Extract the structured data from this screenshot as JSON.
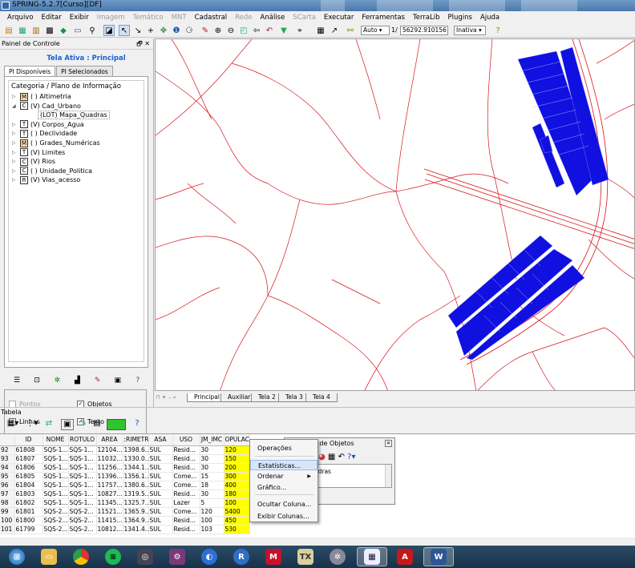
{
  "window": {
    "title": "SPRING-5.2.7[Curso][DF]"
  },
  "menu": [
    {
      "label": "Arquivo",
      "enabled": true
    },
    {
      "label": "Editar",
      "enabled": true
    },
    {
      "label": "Exibir",
      "enabled": true
    },
    {
      "label": "Imagem",
      "enabled": false
    },
    {
      "label": "Temático",
      "enabled": false
    },
    {
      "label": "MNT",
      "enabled": false
    },
    {
      "label": "Cadastral",
      "enabled": true
    },
    {
      "label": "Rede",
      "enabled": false
    },
    {
      "label": "Análise",
      "enabled": true
    },
    {
      "label": "SCarta",
      "enabled": false
    },
    {
      "label": "Executar",
      "enabled": true
    },
    {
      "label": "Ferramentas",
      "enabled": true
    },
    {
      "label": "TerraLib",
      "enabled": true
    },
    {
      "label": "Plugins",
      "enabled": true
    },
    {
      "label": "Ajuda",
      "enabled": true
    }
  ],
  "toolbar": {
    "scale_mode": "Auto",
    "scale_prefix": "1/",
    "scale_value": "56292.910156",
    "state": "Inativa"
  },
  "panel": {
    "title": "Painel de Controle",
    "close_glyph": "🗗 ✕",
    "active_plane": "Tela Ativa : Principal",
    "tabs": [
      "PI Disponíveis",
      "PI Selecionados"
    ],
    "category_header": "Categoria / Plano de Informação",
    "tree": [
      {
        "icon": "M",
        "label": "( ) Altimetria",
        "expanded": false
      },
      {
        "icon": "C",
        "label": "(V) Cad_Urbano",
        "expanded": true
      },
      {
        "icon": "",
        "label": "(LOT) Mapa_Quadras",
        "child": true
      },
      {
        "icon": "T",
        "label": "(V) Corpos_Agua",
        "expanded": false
      },
      {
        "icon": "T",
        "label": "( ) Declividade",
        "expanded": false
      },
      {
        "icon": "M",
        "label": "( ) Grades_Numéricas",
        "expanded": false
      },
      {
        "icon": "T",
        "label": "(V) Limites",
        "expanded": false
      },
      {
        "icon": "C",
        "label": "(V) Rios",
        "expanded": false
      },
      {
        "icon": "C",
        "label": "( ) Unidade_Politica",
        "expanded": false
      },
      {
        "icon": "R",
        "label": "(V) Vias_acesso",
        "expanded": false
      }
    ],
    "visibility": {
      "pontos": {
        "label": "Pontos",
        "checked": false
      },
      "objetos": {
        "label": "Objetos",
        "checked": true
      },
      "linhas": {
        "label": "Linhas",
        "checked": true
      },
      "texto": {
        "label": "Texto",
        "checked": true
      }
    }
  },
  "map_tabs": [
    "Principal",
    "Auxiliar",
    "Tela 2",
    "Tela 3",
    "Tela 4"
  ],
  "map_tab_nav": "⊓ ✦ – »",
  "colors": {
    "block_fill": "#1010e0",
    "road_line": "#d8141c",
    "highlight": "#ffff00"
  },
  "table": {
    "title": "Tabela",
    "columns": [
      "",
      "ID",
      "NOME",
      "ROTULO",
      "AREA",
      ":RIMETR",
      "ASA",
      "USO",
      "JM_IMC",
      "OPULAC"
    ],
    "rows": [
      [
        "92",
        "61808",
        "SQS-1...",
        "SQS-1...",
        "12104...",
        "1398.6...",
        "SUL",
        "Resid...",
        "30",
        "120"
      ],
      [
        "93",
        "61807",
        "SQS-1...",
        "SQS-1...",
        "11032...",
        "1330.0...",
        "SUL",
        "Resid...",
        "30",
        "150"
      ],
      [
        "94",
        "61806",
        "SQS-1...",
        "SQS-1...",
        "11256...",
        "1344.1...",
        "SUL",
        "Resid...",
        "30",
        "200"
      ],
      [
        "95",
        "61805",
        "SQS-1...",
        "SQS-1...",
        "11396...",
        "1356.1...",
        "SUL",
        "Come...",
        "15",
        "300"
      ],
      [
        "96",
        "61804",
        "SQS-1...",
        "SQS-1...",
        "11757...",
        "1380.6...",
        "SUL",
        "Come...",
        "18",
        "400"
      ],
      [
        "97",
        "61803",
        "SQS-1...",
        "SQS-1...",
        "10827...",
        "1319.5...",
        "SUL",
        "Resid...",
        "30",
        "180"
      ],
      [
        "98",
        "61802",
        "SQS-1...",
        "SQS-1...",
        "11345...",
        "1325.7...",
        "SUL",
        "Lazer",
        "5",
        "100"
      ],
      [
        "99",
        "61801",
        "SQS-2...",
        "SQS-2...",
        "11521...",
        "1365.9...",
        "SUL",
        "Come...",
        "120",
        "5400"
      ],
      [
        "100",
        "61800",
        "SQS-2...",
        "SQS-2...",
        "11415...",
        "1364.9...",
        "SUL",
        "Resid...",
        "100",
        "450"
      ],
      [
        "101",
        "61799",
        "SQS-2...",
        "SQS-2...",
        "10812...",
        "1341.4...",
        "SUL",
        "Resid...",
        "103",
        "530"
      ]
    ]
  },
  "context_menu": [
    {
      "label": "Operações"
    },
    {
      "label": "Estatísticas...",
      "hover": true
    },
    {
      "label": "Ordenar",
      "submenu": true
    },
    {
      "label": "Gráfico..."
    },
    {
      "label": "Ocultar Coluna..."
    },
    {
      "label": "Exibir Colunas..."
    }
  ],
  "objects_dialog": {
    "title": "o de Objetos",
    "list_item": "adras"
  },
  "taskbar_apps": [
    "start",
    "explorer",
    "chrome",
    "spotify",
    "app",
    "settings",
    "browser",
    "r-studio",
    "mapper",
    "tex",
    "manager",
    "spring",
    "acrobat",
    "word"
  ]
}
